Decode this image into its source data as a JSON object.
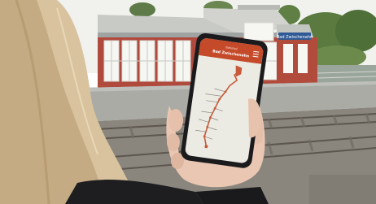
{
  "scene": {
    "sky_color": "#f1f2ee",
    "station_roof_color": "#c8cac5",
    "station_wall_color": "#b04a3c",
    "platform_color": "#a9aba4",
    "track_color": "#6f6a63",
    "hair_color": "#d9c39f",
    "hand_color": "#e9c7b3"
  },
  "station_sign": {
    "text": "Bad Zwischenahn",
    "color": "#2f5a95"
  },
  "phone": {
    "frame_color": "#1b1b1d",
    "app_header": {
      "title": "Bad Zwischenahn",
      "subtitle": "Bahnhof",
      "color": "#c54a2a"
    },
    "menu_icon": "hamburger-menu-icon",
    "screen_bg": "#ecebe3",
    "route_color": "#c75a3a"
  }
}
